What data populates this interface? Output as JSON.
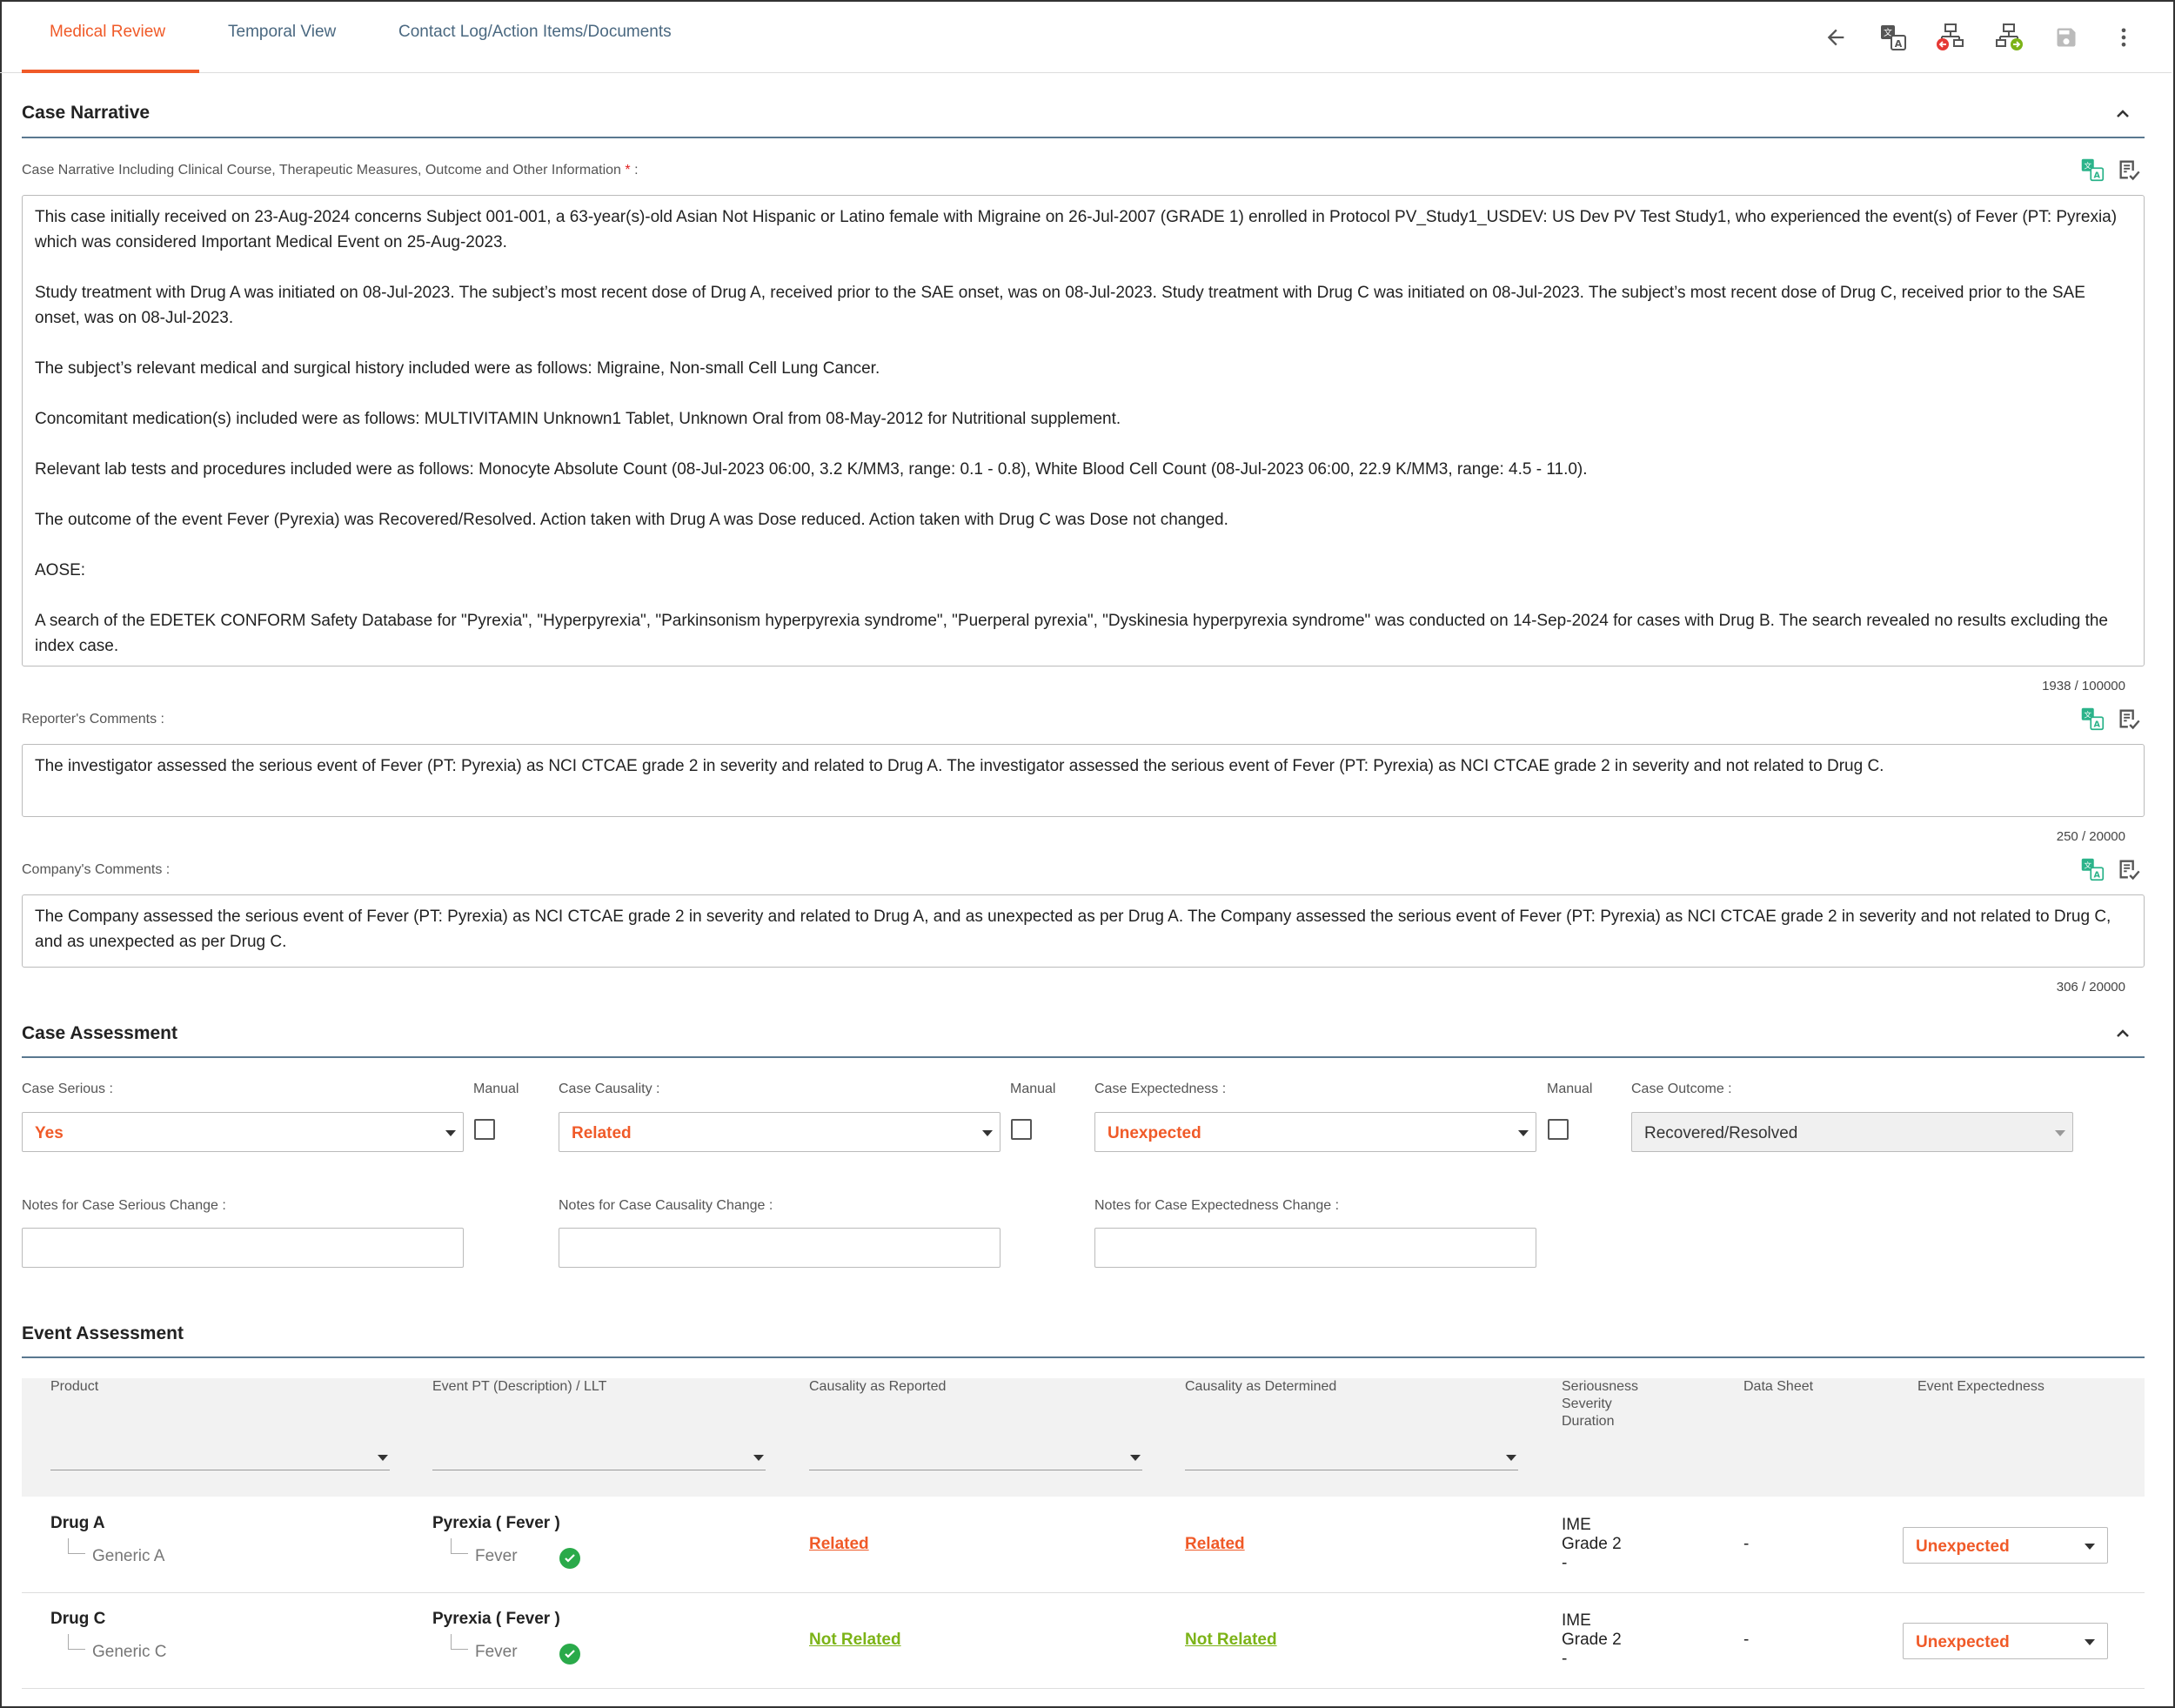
{
  "tabs": [
    {
      "label": "Medical Review",
      "active": true
    },
    {
      "label": "Temporal View",
      "active": false
    },
    {
      "label": "Contact Log/Action Items/Documents",
      "active": false
    }
  ],
  "toolbar": {
    "icons": [
      "back-arrow-icon",
      "translate-icon",
      "workflow-reject-icon",
      "workflow-forward-icon",
      "save-icon",
      "more-vert-icon"
    ]
  },
  "case_narrative": {
    "title": "Case Narrative",
    "field_label": "Case Narrative Including Clinical Course, Therapeutic Measures, Outcome and Other Information",
    "required_mark": "*",
    "label_suffix": ":",
    "paragraphs": [
      "This case initially received on 23-Aug-2024 concerns Subject 001-001, a 63-year(s)-old Asian Not Hispanic or Latino female with Migraine on 26-Jul-2007 (GRADE 1) enrolled in Protocol PV_Study1_USDEV: US Dev PV Test Study1, who experienced the event(s) of Fever (PT: Pyrexia) which was considered Important Medical Event on 25-Aug-2023.",
      "Study treatment with Drug A was initiated on 08-Jul-2023. The subject’s most recent dose of Drug A, received prior to the SAE onset, was on 08-Jul-2023. Study treatment with Drug C was initiated on 08-Jul-2023. The subject’s most recent dose of Drug C, received prior to the SAE onset, was on 08-Jul-2023.",
      "The subject’s relevant medical and surgical history included were as follows: Migraine, Non-small Cell Lung Cancer.",
      "Concomitant medication(s) included were as follows: MULTIVITAMIN  Unknown1 Tablet, Unknown Oral from 08-May-2012 for Nutritional supplement.",
      "Relevant lab tests and procedures included were as follows: Monocyte Absolute Count (08-Jul-2023 06:00, 3.2 K/MM3, range: 0.1 - 0.8), White Blood Cell Count (08-Jul-2023 06:00, 22.9 K/MM3, range: 4.5 - 11.0).",
      "The outcome of the event Fever (Pyrexia) was Recovered/Resolved. Action taken with Drug A was Dose reduced. Action taken with Drug C was Dose not changed.",
      "AOSE:",
      "A search of the EDETEK CONFORM Safety Database for \"Pyrexia\", \"Hyperpyrexia\", \"Parkinsonism hyperpyrexia syndrome\", \"Puerperal pyrexia\", \"Dyskinesia hyperpyrexia syndrome\" was conducted on 14-Sep-2024 for cases with Drug B. The search revealed no results excluding the index case."
    ],
    "counter": "1938 / 100000"
  },
  "reporter_comments": {
    "label": "Reporter's Comments :",
    "text": "The investigator assessed the serious event of Fever (PT: Pyrexia) as NCI CTCAE grade 2 in severity and related to Drug A. The investigator assessed the serious event of Fever (PT: Pyrexia) as NCI CTCAE grade 2 in severity and not related to Drug C.",
    "counter": "250 / 20000"
  },
  "company_comments": {
    "label": "Company's Comments :",
    "text": "The Company assessed the serious event of Fever (PT: Pyrexia) as NCI CTCAE grade 2 in severity and related to Drug A, and as unexpected as per Drug A. The Company assessed the serious event of Fever (PT: Pyrexia) as NCI CTCAE grade 2 in severity and not related to Drug C, and as unexpected as per Drug C.",
    "counter": "306 / 20000"
  },
  "case_assessment": {
    "title": "Case Assessment",
    "serious_label": "Case Serious :",
    "serious_value": "Yes",
    "causality_label": "Case Causality :",
    "causality_value": "Related",
    "expectedness_label": "Case Expectedness :",
    "expectedness_value": "Unexpected",
    "outcome_label": "Case Outcome :",
    "outcome_value": "Recovered/Resolved",
    "manual_label": "Manual",
    "notes_serious_label": "Notes for Case Serious Change :",
    "notes_causality_label": "Notes for Case Causality Change :",
    "notes_expectedness_label": "Notes for Case Expectedness Change :"
  },
  "event_assessment": {
    "title": "Event Assessment",
    "columns": {
      "product": "Product",
      "event": "Event PT (Description) / LLT",
      "causality_reported": "Causality as Reported",
      "causality_determined": "Causality as Determined",
      "seriousness": [
        "Seriousness",
        "Severity",
        "Duration"
      ],
      "data_sheet": "Data Sheet",
      "expectedness": "Event Expectedness"
    },
    "rows": [
      {
        "product": "Drug A",
        "generic": "Generic A",
        "event_pt": "Pyrexia ( Fever )",
        "event_llt": "Fever",
        "causality_reported": "Related",
        "causality_determined": "Related",
        "seriousness": "IME",
        "severity": "Grade 2",
        "duration": "-",
        "data_sheet": "-",
        "expectedness": "Unexpected"
      },
      {
        "product": "Drug C",
        "generic": "Generic C",
        "event_pt": "Pyrexia ( Fever )",
        "event_llt": "Fever",
        "causality_reported": "Not Related",
        "causality_determined": "Not Related",
        "seriousness": "IME",
        "severity": "Grade 2",
        "duration": "-",
        "data_sheet": "-",
        "expectedness": "Unexpected"
      }
    ]
  },
  "colors": {
    "accent": "#f05a28",
    "not_related": "#7cb317",
    "section_rule": "#5a7890",
    "tab_text": "#4a6880"
  }
}
